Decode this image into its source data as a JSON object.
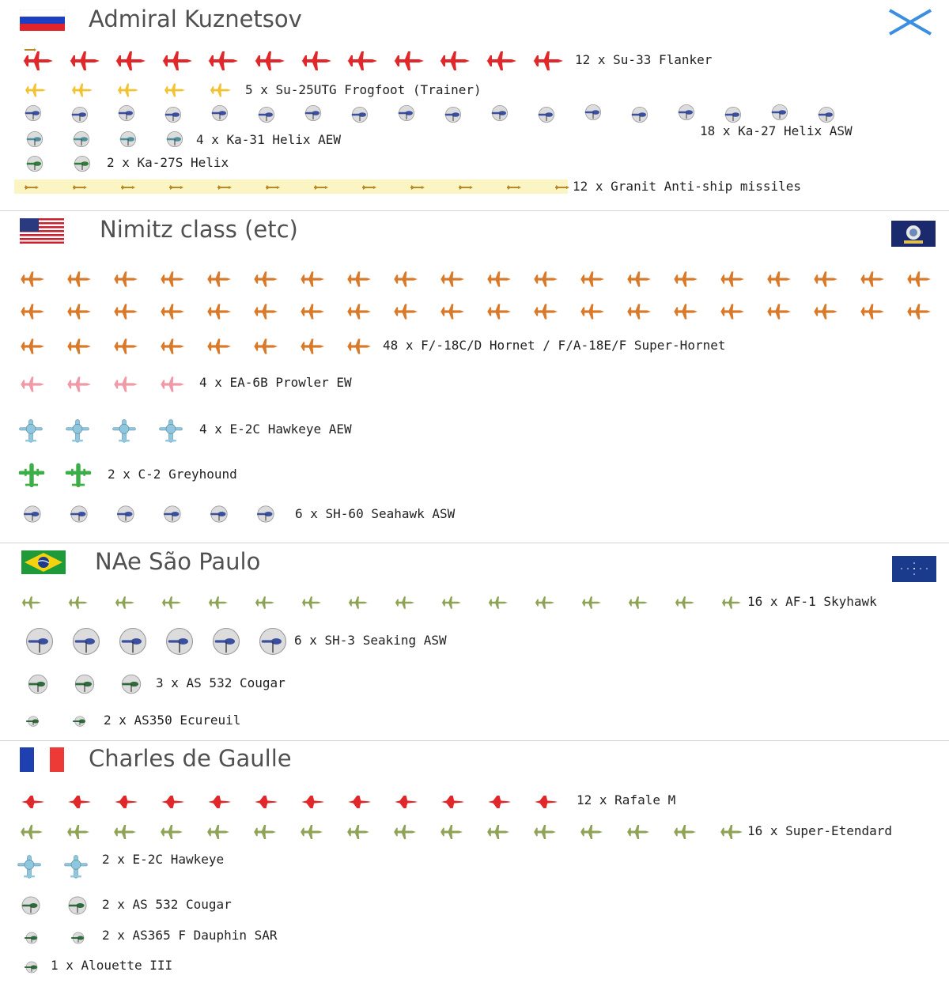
{
  "carriers": [
    {
      "name": "Admiral Kuznetsov",
      "flag": "russia-flag",
      "ensign": "st-andrew-cross-ensign",
      "groups": [
        {
          "count": 12,
          "label": "12 x Su-33 Flanker",
          "icon": "red-jet-icon",
          "color": "#e0282a"
        },
        {
          "count": 5,
          "label": "5 x Su-25UTG Frogfoot (Trainer)",
          "icon": "yellow-jet-icon",
          "color": "#f2c230"
        },
        {
          "count": 18,
          "label": "18 x Ka-27 Helix ASW",
          "icon": "blue-helicopter-icon",
          "color": "#3a4fa0"
        },
        {
          "count": 4,
          "label": "4 x Ka-31 Helix AEW",
          "icon": "teal-helicopter-icon",
          "color": "#4e8f9c"
        },
        {
          "count": 2,
          "label": "2 x Ka-27S Helix",
          "icon": "green-helicopter-icon",
          "color": "#2e7d3a"
        },
        {
          "count": 12,
          "label": "12 x Granit Anti-ship missiles",
          "icon": "missile-icon",
          "color": "#b58a2a"
        }
      ]
    },
    {
      "name": "Nimitz class (etc)",
      "flag": "usa-flag",
      "ensign": "us-navy-flag",
      "groups": [
        {
          "count": 48,
          "label": "48 x F/-18C/D Hornet / F/A-18E/F Super-Hornet",
          "icon": "orange-jet-icon",
          "color": "#d97a2b"
        },
        {
          "count": 4,
          "label": "4 x EA-6B Prowler EW",
          "icon": "pink-jet-icon",
          "color": "#f09aa8"
        },
        {
          "count": 4,
          "label": "4 x E-2C Hawkeye AEW",
          "icon": "light-blue-aew-icon",
          "color": "#8fc7de"
        },
        {
          "count": 2,
          "label": "2 x C-2 Greyhound",
          "icon": "green-prop-plane-icon",
          "color": "#3cae47"
        },
        {
          "count": 6,
          "label": "6 x SH-60 Seahawk ASW",
          "icon": "blue-helicopter-icon",
          "color": "#3a4fa0"
        }
      ]
    },
    {
      "name": "NAe São Paulo",
      "flag": "brazil-flag",
      "ensign": "brazil-navy-jack",
      "groups": [
        {
          "count": 16,
          "label": "16 x AF-1 Skyhawk",
          "icon": "olive-jet-icon",
          "color": "#8fa356"
        },
        {
          "count": 6,
          "label": "6 x SH-3 Seaking ASW",
          "icon": "blue-helicopter-icon",
          "color": "#3a4fa0"
        },
        {
          "count": 3,
          "label": "3 x AS 532 Cougar",
          "icon": "green-helicopter-icon",
          "color": "#2e6b3a"
        },
        {
          "count": 2,
          "label": "2 x AS350 Ecureuil",
          "icon": "small-green-helicopter-icon",
          "color": "#2e6b3a"
        }
      ]
    },
    {
      "name": "Charles de Gaulle",
      "flag": "france-flag",
      "ensign": "",
      "groups": [
        {
          "count": 12,
          "label": "12 x Rafale M",
          "icon": "red-delta-jet-icon",
          "color": "#e0282a"
        },
        {
          "count": 16,
          "label": "16 x Super-Etendard",
          "icon": "olive-jet-icon",
          "color": "#8fa356"
        },
        {
          "count": 2,
          "label": "2 x E-2C Hawkeye",
          "icon": "light-blue-aew-icon",
          "color": "#8fc7de"
        },
        {
          "count": 2,
          "label": "2 x AS 532 Cougar",
          "icon": "green-helicopter-icon",
          "color": "#2e6b3a"
        },
        {
          "count": 2,
          "label": "2 x AS365 F Dauphin SAR",
          "icon": "small-green-helicopter-icon",
          "color": "#2e6b3a"
        },
        {
          "count": 1,
          "label": "1 x Alouette III",
          "icon": "small-green-helicopter-icon",
          "color": "#2e6b3a"
        }
      ]
    }
  ]
}
